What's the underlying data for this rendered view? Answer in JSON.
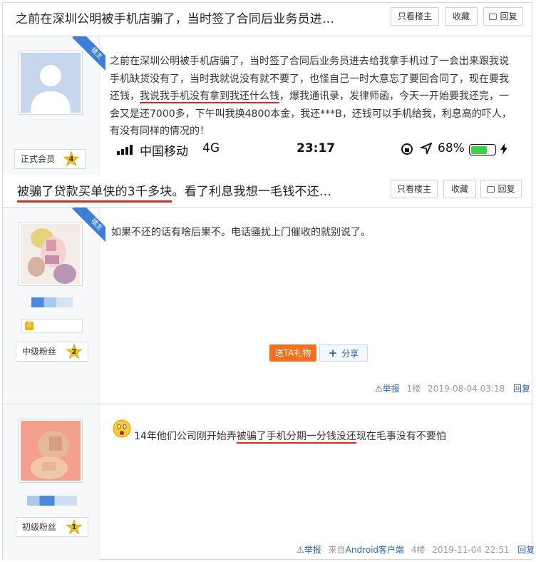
{
  "thread1": {
    "title": "之前在深圳公明被手机店骗了，当时签了合同后业务员进…",
    "btn_only_op": "只看楼主",
    "btn_favorite": "收藏",
    "btn_reply": "回复"
  },
  "post1": {
    "badge": "楼主",
    "level": "正式会员",
    "level_num": "4",
    "text_a": "之前在深圳公明被手机店骗了，当时签了合同后业务员进去给我拿手机过了一会出来跟我说手机缺货没有了，当时我就说没有就不要了，也怪自己一时大意忘了要回合同了，现在要我还钱，",
    "text_hl": "我说我手机没有拿到我还什么钱",
    "text_b": "，爆我通讯录，发律师函，今天一开始要我还完，一会又是还7000多，下午叫我换4800本金，我还***B，还钱可以手机给我，利息高的吓人，有没有同样的情况的！",
    "status_carrier": "中国移动",
    "status_network": "4G",
    "status_time": "23:17",
    "status_battery": "68%"
  },
  "thread2": {
    "title_hl": "被骗了贷款买单侠的3千多块",
    "title_rest": "。看了利息我想一毛钱不还…",
    "btn_only_op": "只看楼主",
    "btn_favorite": "收藏",
    "btn_reply": "回复"
  },
  "post2": {
    "badge": "楼主",
    "level": "中级粉丝",
    "level_num": "2",
    "text": "如果不还的话有啥后果不。电话骚扰上门催收的就别说了。",
    "btn_gift": "送TA礼物",
    "btn_share": "分享",
    "report": "举报",
    "floor": "1楼",
    "time": "2019-08-04 03:18",
    "reply": "回复"
  },
  "post3": {
    "level": "初级粉丝",
    "level_num": "1",
    "text_a": "14年他们公司刚开始弄",
    "text_hl": "被骗了手机分期一分钱没还",
    "text_b": "现在毛事没有不要怕",
    "report": "举报",
    "source_prefix": "来自",
    "source": "Android客户端",
    "floor": "4楼",
    "time": "2019-11-04 22:51",
    "reply": "回复"
  },
  "colors": {
    "underline_red": "#d42a2a",
    "link_blue": "#2d64b3",
    "badge_blue": "#3d7fd8",
    "gift_orange": "#f37022"
  }
}
